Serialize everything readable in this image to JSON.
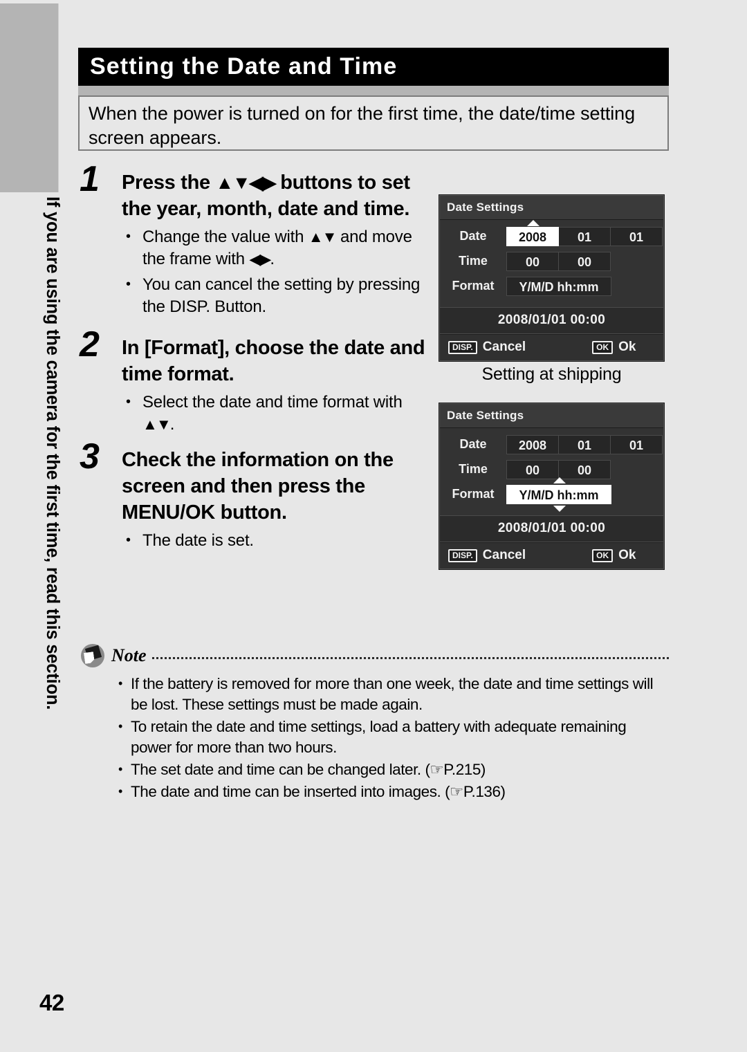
{
  "page": {
    "number": "42",
    "side_caption": "If you are using the camera for the first time, read this section."
  },
  "header": {
    "title": "Setting the Date and Time",
    "intro": "When the power is turned on for the first time, the date/time setting screen appears."
  },
  "steps": [
    {
      "number": "1",
      "heading_parts": {
        "before": "Press the ",
        "arrows": "▲▼◀▶",
        "after": " buttons to set the year, month, date and time."
      },
      "bullets": [
        {
          "before": "Change the value with ",
          "arrows": "▲▼",
          "middle": " and move the frame with ",
          "arrows2": "◀▶",
          "after": "."
        },
        {
          "before": "You can cancel the setting by pressing the DISP. Button.",
          "arrows": "",
          "middle": "",
          "arrows2": "",
          "after": ""
        }
      ]
    },
    {
      "number": "2",
      "heading_parts": {
        "before": "In [Format], choose the date and time format.",
        "arrows": "",
        "after": ""
      },
      "bullets": [
        {
          "before": "Select the date and time format with ",
          "arrows": "▲▼",
          "middle": "",
          "arrows2": "",
          "after": "."
        }
      ]
    },
    {
      "number": "3",
      "heading_parts": {
        "before": "Check the information on the screen and then press the MENU/OK button.",
        "arrows": "",
        "after": ""
      },
      "bullets": [
        {
          "before": "The date is set.",
          "arrows": "",
          "middle": "",
          "arrows2": "",
          "after": ""
        }
      ]
    }
  ],
  "screens": [
    {
      "id": "date-settings-year-selected",
      "title": "Date Settings",
      "rows": [
        {
          "label": "Date",
          "fields": [
            "2008",
            "01",
            "01"
          ],
          "selected_index": 0
        },
        {
          "label": "Time",
          "fields": [
            "00",
            "00"
          ],
          "selected_index": -1
        },
        {
          "label": "Format",
          "fields": [
            "Y/M/D hh:mm"
          ],
          "selected_index": -1
        }
      ],
      "summary": "2008/01/01  00:00",
      "footer": {
        "cancel_key": "DISP.",
        "cancel_label": "Cancel",
        "ok_key": "OK",
        "ok_label": "Ok"
      },
      "caption": "Setting at shipping"
    },
    {
      "id": "date-settings-format-selected",
      "title": "Date Settings",
      "rows": [
        {
          "label": "Date",
          "fields": [
            "2008",
            "01",
            "01"
          ],
          "selected_index": -1
        },
        {
          "label": "Time",
          "fields": [
            "00",
            "00"
          ],
          "selected_index": -1
        },
        {
          "label": "Format",
          "fields": [
            "Y/M/D hh:mm"
          ],
          "selected_index": 0
        }
      ],
      "summary": "2008/01/01  00:00",
      "footer": {
        "cancel_key": "DISP.",
        "cancel_label": "Cancel",
        "ok_key": "OK",
        "ok_label": "Ok"
      },
      "caption": ""
    }
  ],
  "note": {
    "label": "Note",
    "items": [
      "If the battery is removed for more than one week, the date and time settings will be lost. These settings must be made again.",
      "To retain the date and time settings, load a battery with adequate remaining power for more than two hours.",
      "The set date and time can be changed later. (☞P.215)",
      "The date and time can be inserted into images. (☞P.136)"
    ]
  }
}
